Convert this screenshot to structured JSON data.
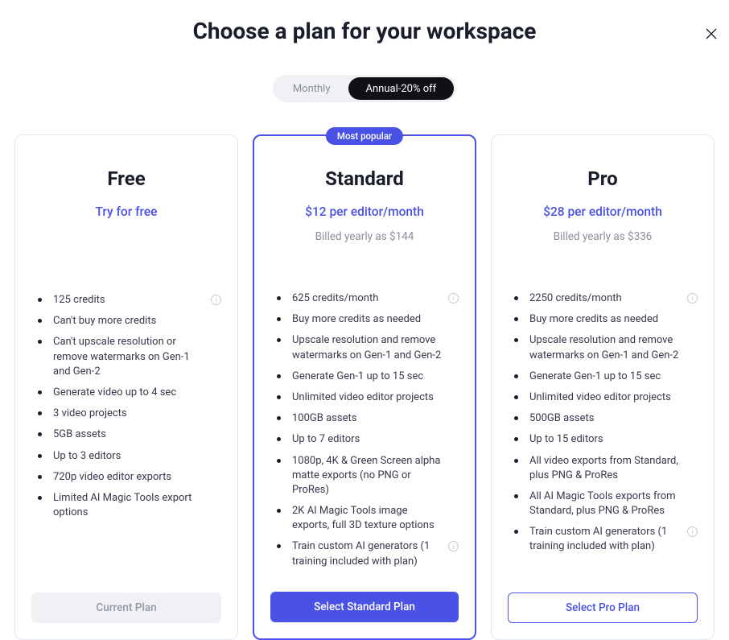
{
  "title": "Choose a plan for your workspace",
  "toggle": {
    "monthly": "Monthly",
    "annual": "Annual-20% off"
  },
  "badge": "Most popular",
  "plans": {
    "free": {
      "name": "Free",
      "price": "Try for free",
      "billed": "",
      "features": [
        "125 credits",
        "Can't buy more credits",
        "Can't upscale resolution or remove watermarks on Gen-1 and Gen-2",
        "Generate video up to 4 sec",
        "3 video projects",
        "5GB assets",
        "Up to 3 editors",
        "720p video editor exports",
        "Limited AI Magic Tools export options"
      ],
      "button": "Current Plan"
    },
    "standard": {
      "name": "Standard",
      "price": "$12 per editor/month",
      "billed": "Billed yearly as $144",
      "features": [
        "625 credits/month",
        "Buy more credits as needed",
        "Upscale resolution and remove watermarks on Gen-1 and Gen-2",
        "Generate Gen-1 up to 15 sec",
        "Unlimited video editor projects",
        "100GB assets",
        "Up to 7 editors",
        "1080p, 4K & Green Screen alpha matte exports (no PNG or ProRes)",
        "2K AI Magic Tools image exports, full 3D texture options",
        "Train custom AI generators (1 training included with plan)"
      ],
      "button": "Select Standard Plan"
    },
    "pro": {
      "name": "Pro",
      "price": "$28 per editor/month",
      "billed": "Billed yearly as $336",
      "features": [
        "2250 credits/month",
        "Buy more credits as needed",
        "Upscale resolution and remove watermarks on Gen-1 and Gen-2",
        "Generate Gen-1 up to 15 sec",
        "Unlimited video editor projects",
        "500GB assets",
        "Up to 15 editors",
        "All video exports from Standard, plus PNG & ProRes",
        "All AI Magic Tools exports from Standard, plus PNG & ProRes",
        "Train custom AI generators (1 training included with plan)"
      ],
      "button": "Select Pro Plan"
    }
  }
}
